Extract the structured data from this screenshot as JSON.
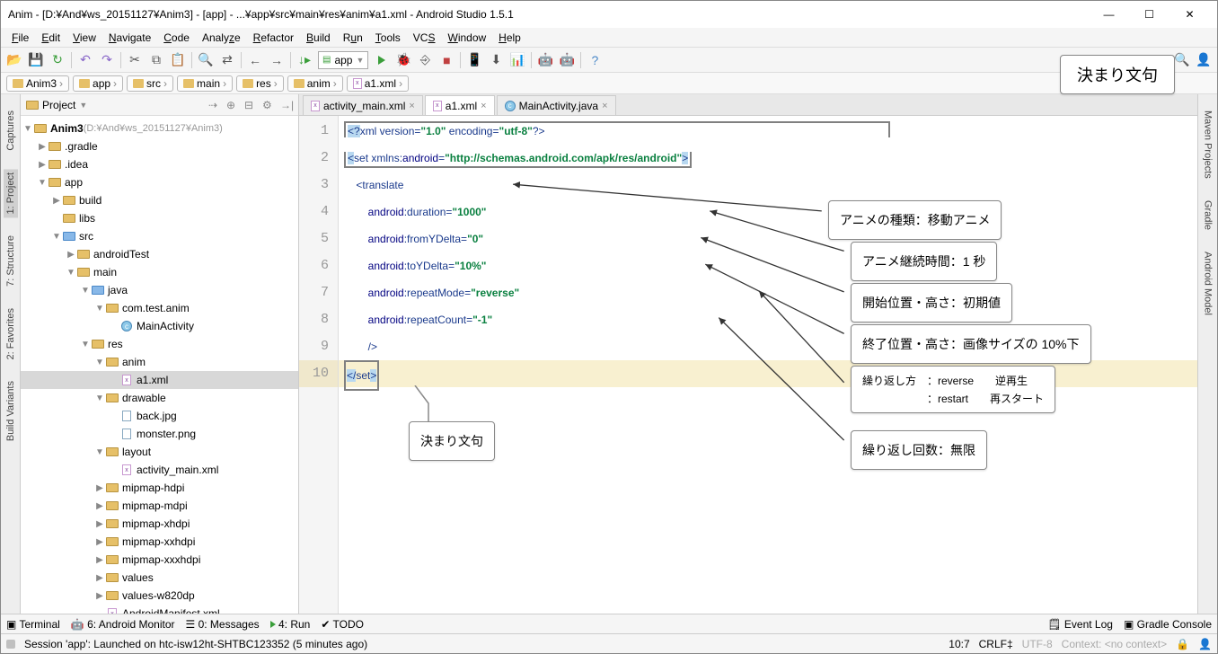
{
  "titlebar": {
    "title": "Anim - [D:¥And¥ws_20151127¥Anim3] - [app] - ...¥app¥src¥main¥res¥anim¥a1.xml - Android Studio 1.5.1"
  },
  "menu": {
    "file": "File",
    "edit": "Edit",
    "view": "View",
    "navigate": "Navigate",
    "code": "Code",
    "analyze": "Analyze",
    "refactor": "Refactor",
    "build": "Build",
    "run": "Run",
    "tools": "Tools",
    "vcs": "VCS",
    "window": "Window",
    "help": "Help"
  },
  "toolbar": {
    "config": "app"
  },
  "breadcrumbs": [
    "Anim3",
    "app",
    "src",
    "main",
    "res",
    "anim",
    "a1.xml"
  ],
  "left_tabs": [
    "Captures",
    "1: Project",
    "7: Structure",
    "2: Favorites",
    "Build Variants"
  ],
  "right_tabs": [
    "Maven Projects",
    "Gradle",
    "Android Model"
  ],
  "project_header": {
    "label": "Project"
  },
  "tree": {
    "root": "Anim3",
    "root_path": " (D:¥And¥ws_20151127¥Anim3)",
    "n_gradle": ".gradle",
    "n_idea": ".idea",
    "n_app": "app",
    "n_build": "build",
    "n_libs": "libs",
    "n_src": "src",
    "n_androidTest": "androidTest",
    "n_main": "main",
    "n_java": "java",
    "n_pkg": "com.test.anim",
    "n_activity": "MainActivity",
    "n_res": "res",
    "n_anim": "anim",
    "n_a1": "a1.xml",
    "n_drawable": "drawable",
    "n_back": "back.jpg",
    "n_monster": "monster.png",
    "n_layout": "layout",
    "n_actmain": "activity_main.xml",
    "n_mip_h": "mipmap-hdpi",
    "n_mip_m": "mipmap-mdpi",
    "n_mip_xh": "mipmap-xhdpi",
    "n_mip_xxh": "mipmap-xxhdpi",
    "n_mip_xxxh": "mipmap-xxxhdpi",
    "n_values": "values",
    "n_values820": "values-w820dp",
    "n_manifest": "AndroidManifest.xml"
  },
  "editor_tabs": {
    "t1": "activity_main.xml",
    "t2": "a1.xml",
    "t3": "MainActivity.java"
  },
  "code": {
    "l1a": "<?",
    "l1b": "xml version=",
    "l1c": "\"1.0\"",
    "l1d": " encoding=",
    "l1e": "\"utf-8\"",
    "l1f": "?>",
    "l2a": "<",
    "l2b": "set ",
    "l2c": "xmlns:",
    "l2d": "android",
    "l2e": "=",
    "l2f": "\"http://schemas.android.com/apk/res/android\"",
    "l2g": ">",
    "l3a": "<",
    "l3b": "translate",
    "l4a": "android",
    "l4b": ":duration=",
    "l4c": "\"1000\"",
    "l5a": "android",
    "l5b": ":fromYDelta=",
    "l5c": "\"0\"",
    "l6a": "android",
    "l6b": ":toYDelta=",
    "l6c": "\"10%\"",
    "l7a": "android",
    "l7b": ":repeatMode=",
    "l7c": "\"reverse\"",
    "l8a": "android",
    "l8b": ":repeatCount=",
    "l8c": "\"-1\"",
    "l9": "/>",
    "l10a": "</",
    "l10b": "set",
    "l10c": ">"
  },
  "annotations": {
    "top": "決まり文句",
    "a_translate": "アニメの種類：移動アニメ",
    "a_duration": "アニメ継続時間：1 秒",
    "a_fromY": "開始位置・高さ：初期値",
    "a_toY": "終了位置・高さ：画像サイズの 10%下",
    "a_repeatMode1": "繰り返し方　：reverse　　逆再生",
    "a_repeatMode2": "　　　　　　：restart　　再スタート",
    "a_repeatCount": "繰り返し回数：無限",
    "bottom": "決まり文句"
  },
  "bottombar": {
    "terminal": "Terminal",
    "monitor": "6: Android Monitor",
    "messages": "0: Messages",
    "run": "4: Run",
    "todo": "TODO",
    "eventlog": "Event Log",
    "gradle": "Gradle Console"
  },
  "status": {
    "msg": "Session 'app': Launched on htc-isw12ht-SHTBC123352 (5 minutes ago)",
    "pos": "10:7",
    "crlf": "CRLF",
    "enc": "UTF-8",
    "context": "Context: <no context>"
  }
}
